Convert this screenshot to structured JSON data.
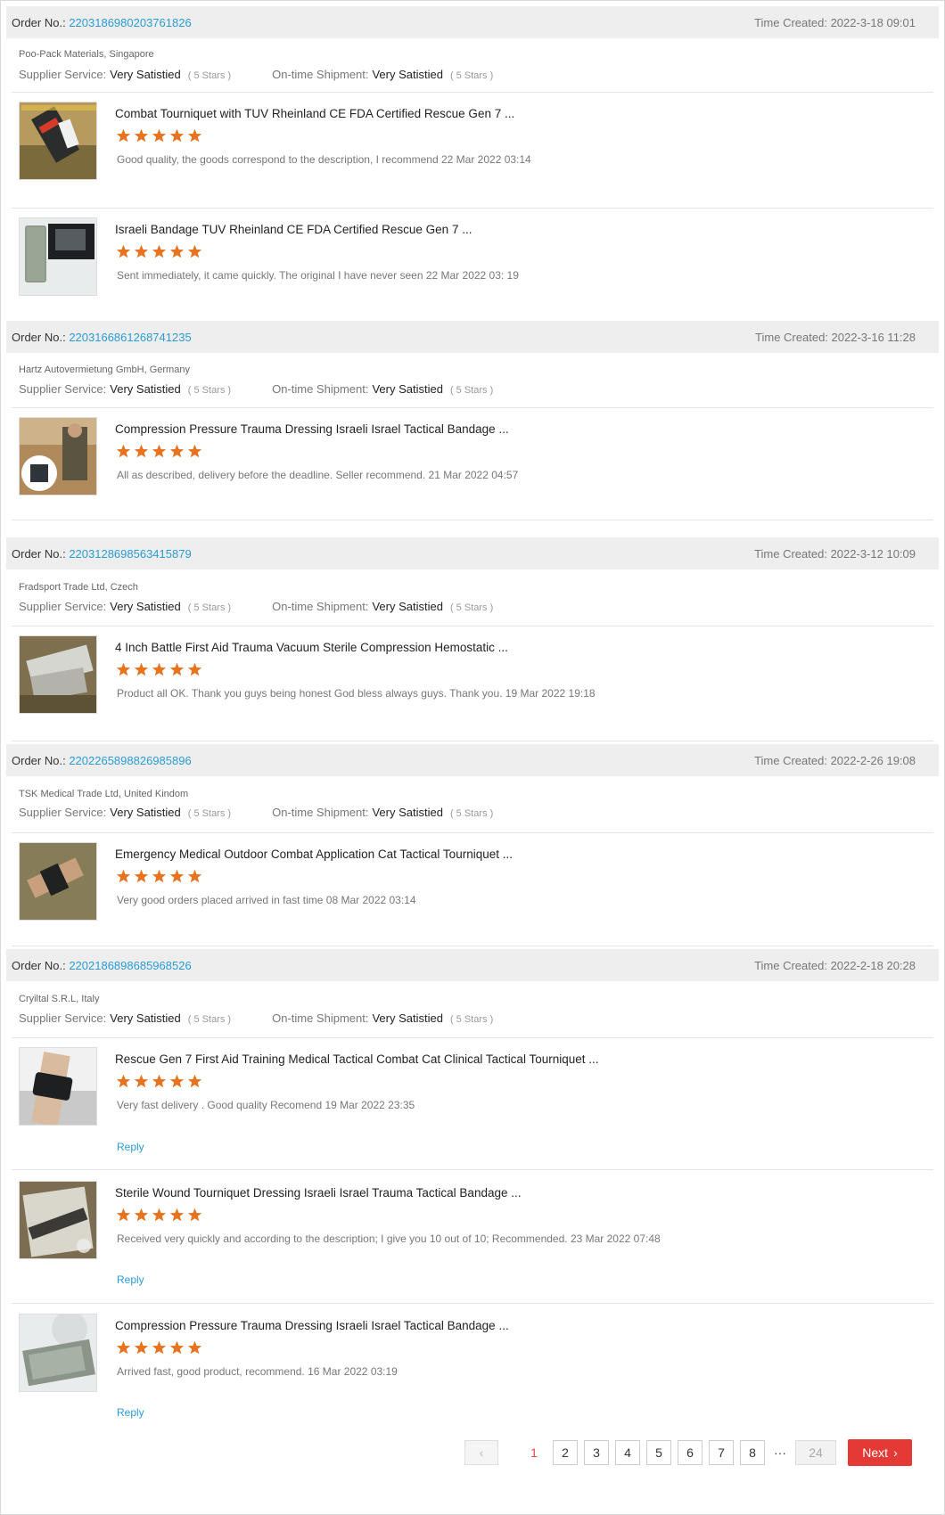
{
  "orders": [
    {
      "order_label": "Order No.:",
      "order_no": "2203186980203761826",
      "time_label": "Time Created:",
      "time": "2022-3-18 09:01",
      "company": "Poo-Pack Materials, Singapore",
      "supplier_label": "Supplier Service:",
      "supplier_value": "Very Satistied",
      "supplier_stars": "( 5 Stars )",
      "shipment_label": "On-time Shipment:",
      "shipment_value": "Very Satistied",
      "shipment_stars": "( 5 Stars )",
      "items": [
        {
          "title": "Combat Tourniquet with TUV Rheinland CE FDA Certified Rescue Gen 7 ...",
          "rating": 5,
          "comment": "Good quality, the goods correspond to the description, I recommend  22 Mar 2022 03:14"
        },
        {
          "title": "Israeli Bandage TUV Rheinland CE FDA Certified Rescue Gen 7 ...",
          "rating": 5,
          "comment": "Sent immediately, it came quickly. The original I have never seen  22 Mar 2022 03: 19"
        }
      ]
    },
    {
      "order_label": "Order No.:",
      "order_no": "2203166861268741235",
      "time_label": "Time Created:",
      "time": "2022-3-16 11:28",
      "company": "Hartz Autovermietung GmbH, Germany",
      "supplier_label": "Supplier Service:",
      "supplier_value": "Very Satistied",
      "supplier_stars": "( 5 Stars )",
      "shipment_label": "On-time Shipment:",
      "shipment_value": "Very Satistied",
      "shipment_stars": "( 5 Stars )",
      "items": [
        {
          "title": "Compression Pressure Trauma Dressing Israeli Israel Tactical Bandage ...",
          "rating": 5,
          "comment": "All as described, delivery before the deadline. Seller recommend. 21 Mar 2022  04:57"
        }
      ]
    },
    {
      "order_label": "Order No.:",
      "order_no": "2203128698563415879",
      "time_label": "Time Created:",
      "time": "2022-3-12 10:09",
      "company": "Fradsport Trade Ltd, Czech",
      "supplier_label": "Supplier Service:",
      "supplier_value": "Very Satistied",
      "supplier_stars": "( 5 Stars )",
      "shipment_label": "On-time Shipment:",
      "shipment_value": "Very Satistied",
      "shipment_stars": "( 5 Stars )",
      "items": [
        {
          "title": "4 Inch Battle First Aid Trauma Vacuum Sterile Compression Hemostatic ...",
          "rating": 5,
          "comment": "Product all OK. Thank you guys being honest God bless always guys. Thank you.  19 Mar 2022 19:18"
        }
      ]
    },
    {
      "order_label": "Order No.:",
      "order_no": "2202265898826985896",
      "time_label": "Time Created:",
      "time": "2022-2-26 19:08",
      "company": "TSK Medical Trade Ltd, United Kindom",
      "supplier_label": "Supplier Service:",
      "supplier_value": "Very Satistied",
      "supplier_stars": "( 5 Stars )",
      "shipment_label": "On-time Shipment:",
      "shipment_value": "Very Satistied",
      "shipment_stars": "( 5 Stars )",
      "items": [
        {
          "title": "Emergency Medical Outdoor Combat Application Cat Tactical Tourniquet ...",
          "rating": 5,
          "comment": "Very good orders placed arrived in fast time  08 Mar 2022 03:14"
        }
      ]
    },
    {
      "order_label": "Order No.:",
      "order_no": "2202186898685968526",
      "time_label": "Time Created:",
      "time": "2022-2-18 20:28",
      "company": "Cryiltal S.R.L, Italy",
      "supplier_label": "Supplier Service:",
      "supplier_value": "Very Satistied",
      "supplier_stars": "( 5 Stars )",
      "shipment_label": "On-time Shipment:",
      "shipment_value": "Very Satistied",
      "shipment_stars": "( 5 Stars )",
      "items": [
        {
          "title": "Rescue Gen 7 First Aid Training Medical Tactical Combat Cat Clinical Tactical Tourniquet ...",
          "rating": 5,
          "comment": "Very fast delivery . Good quality Recomend 19 Mar 2022 23:35",
          "reply": "Reply"
        },
        {
          "title": "Sterile Wound Tourniquet Dressing Israeli Israel Trauma Tactical Bandage ...",
          "rating": 5,
          "comment": "Received very quickly and according to the description; I give you 10 out of 10; Recommended. 23 Mar 2022 07:48",
          "reply": "Reply"
        },
        {
          "title": "Compression Pressure Trauma Dressing Israeli Israel Tactical Bandage ...",
          "rating": 5,
          "comment": "Arrived fast, good product, recommend. 16 Mar 2022 03:19",
          "reply": "Reply"
        }
      ]
    }
  ],
  "thumb_icons": [
    "tourniquet-photo",
    "israeli-bandage-photo",
    "trauma-dressing-photo",
    "hemostatic-bandage-photo",
    "cat-tourniquet-photo",
    "training-tourniquet-photo",
    "wound-dressing-photo",
    "compression-bandage-photo"
  ],
  "pagination": {
    "current": "1",
    "pages": [
      "2",
      "3",
      "4",
      "5",
      "6",
      "7",
      "8"
    ],
    "ellipsis": "···",
    "last": "24",
    "next": "Next"
  },
  "colors": {
    "link": "#2b9bd6",
    "star": "#e8731f",
    "next_button": "#e43a36",
    "header_bg": "#eeeeee"
  }
}
